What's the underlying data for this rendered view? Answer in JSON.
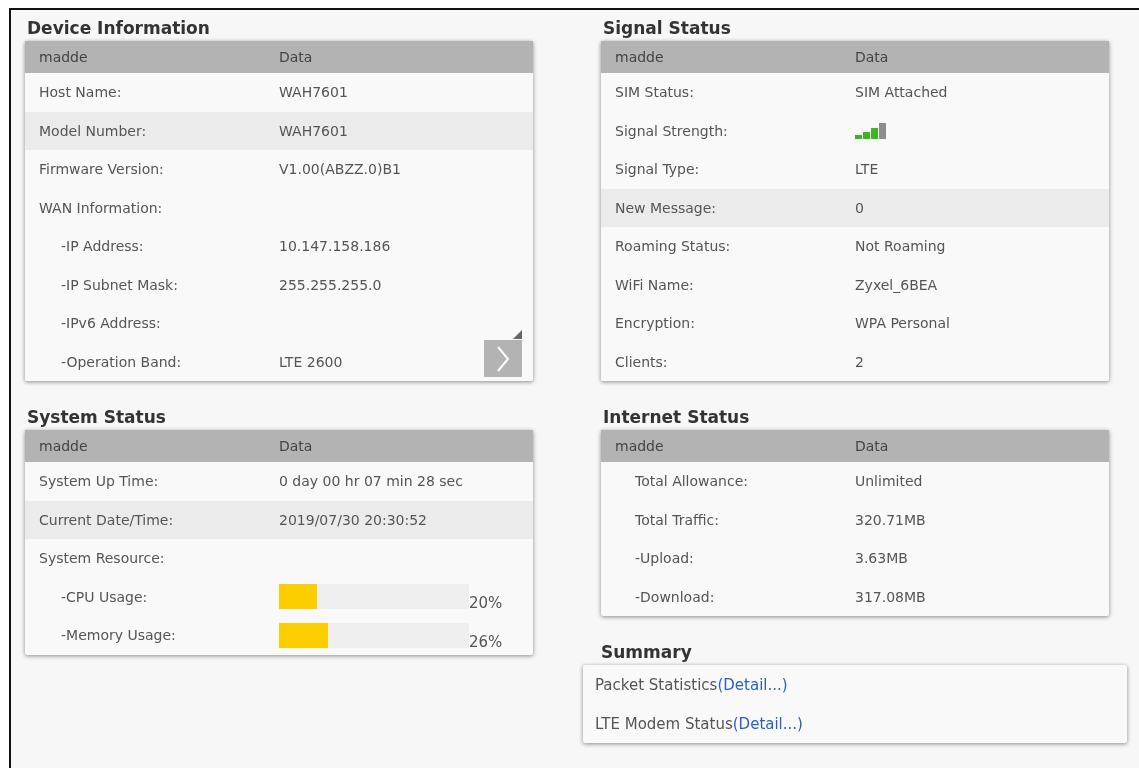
{
  "left": [
    {
      "title": "Device Information",
      "kind": "table",
      "header": [
        "madde",
        "Data"
      ],
      "more_button": true,
      "rows": [
        {
          "label": "Host Name:",
          "value": "WAH7601",
          "kind": "text",
          "highlighted": false
        },
        {
          "label": "Model Number:",
          "value": "WAH7601",
          "kind": "text",
          "highlighted": true
        },
        {
          "label": "Firmware Version:",
          "value": "V1.00(ABZZ.0)B1",
          "kind": "text",
          "highlighted": false
        },
        {
          "label": "WAN Information:",
          "kind": "text",
          "highlighted": false,
          "children": [
            {
              "label": "-IP Address:",
              "value": "10.147.158.186",
              "kind": "text",
              "highlighted": false
            },
            {
              "label": "-IP Subnet Mask:",
              "value": "255.255.255.0",
              "kind": "text",
              "highlighted": false
            },
            {
              "label": "-IPv6 Address:",
              "kind": "text",
              "highlighted": false
            },
            {
              "label": "-Operation Band:",
              "value": "LTE 2600",
              "kind": "text",
              "highlighted": false
            }
          ]
        }
      ]
    },
    {
      "title": "System Status",
      "kind": "table",
      "header": [
        "madde",
        "Data"
      ],
      "rows": [
        {
          "label": "System Up Time:",
          "value": "0 day 00 hr 07 min 28 sec",
          "kind": "text",
          "highlighted": false
        },
        {
          "label": "Current Date/Time:",
          "value": "2019/07/30 20:30:52",
          "kind": "text",
          "highlighted": true
        },
        {
          "label": "System Resource:",
          "kind": "text",
          "highlighted": false,
          "children": [
            {
              "label": "-CPU Usage:",
              "kind": "bar",
              "level": 0.2,
              "reading": "20%",
              "highlighted": false
            },
            {
              "label": "-Memory Usage:",
              "kind": "bar",
              "level": 0.26,
              "reading": "26%",
              "highlighted": false
            }
          ]
        }
      ]
    }
  ],
  "right": [
    {
      "title": "Signal Status",
      "kind": "table",
      "header": [
        "madde",
        "Data"
      ],
      "rows": [
        {
          "label": "SIM Status:",
          "value": "SIM Attached",
          "kind": "text",
          "highlighted": false
        },
        {
          "label": "Signal Strength:",
          "kind": "signal",
          "highlighted": false
        },
        {
          "label": "Signal Type:",
          "value": "LTE",
          "kind": "text",
          "highlighted": false
        },
        {
          "label": "New Message:",
          "value": "0",
          "kind": "text",
          "highlighted": true
        },
        {
          "label": "Roaming Status:",
          "value": "Not Roaming",
          "kind": "text",
          "highlighted": false
        },
        {
          "label": "WiFi Name:",
          "value": "Zyxel_6BEA",
          "kind": "text",
          "highlighted": false
        },
        {
          "label": "Encryption:",
          "value": "WPA Personal",
          "kind": "text",
          "highlighted": false
        },
        {
          "label": "Clients:",
          "value": "2",
          "kind": "text",
          "highlighted": false
        }
      ]
    },
    {
      "title": "Internet Status",
      "kind": "inset-table",
      "header": [
        "madde",
        "Data"
      ],
      "rows": [
        {
          "label": "Total Allowance:",
          "value": "Unlimited",
          "kind": "text",
          "highlighted": false
        },
        {
          "label": "Total Traffic:",
          "value": "320.71MB",
          "kind": "text",
          "highlighted": false
        },
        {
          "label": "-Upload:",
          "value": "3.63MB",
          "kind": "text",
          "highlighted": false
        },
        {
          "label": "-Download:",
          "value": "317.08MB",
          "kind": "text",
          "highlighted": false
        }
      ]
    },
    {
      "title": "Summary",
      "kind": "links",
      "links": [
        {
          "text": "Packet Statistics",
          "link": "(Detail...)"
        },
        {
          "text": "LTE Modem Status",
          "link": "(Detail...)"
        }
      ]
    }
  ]
}
